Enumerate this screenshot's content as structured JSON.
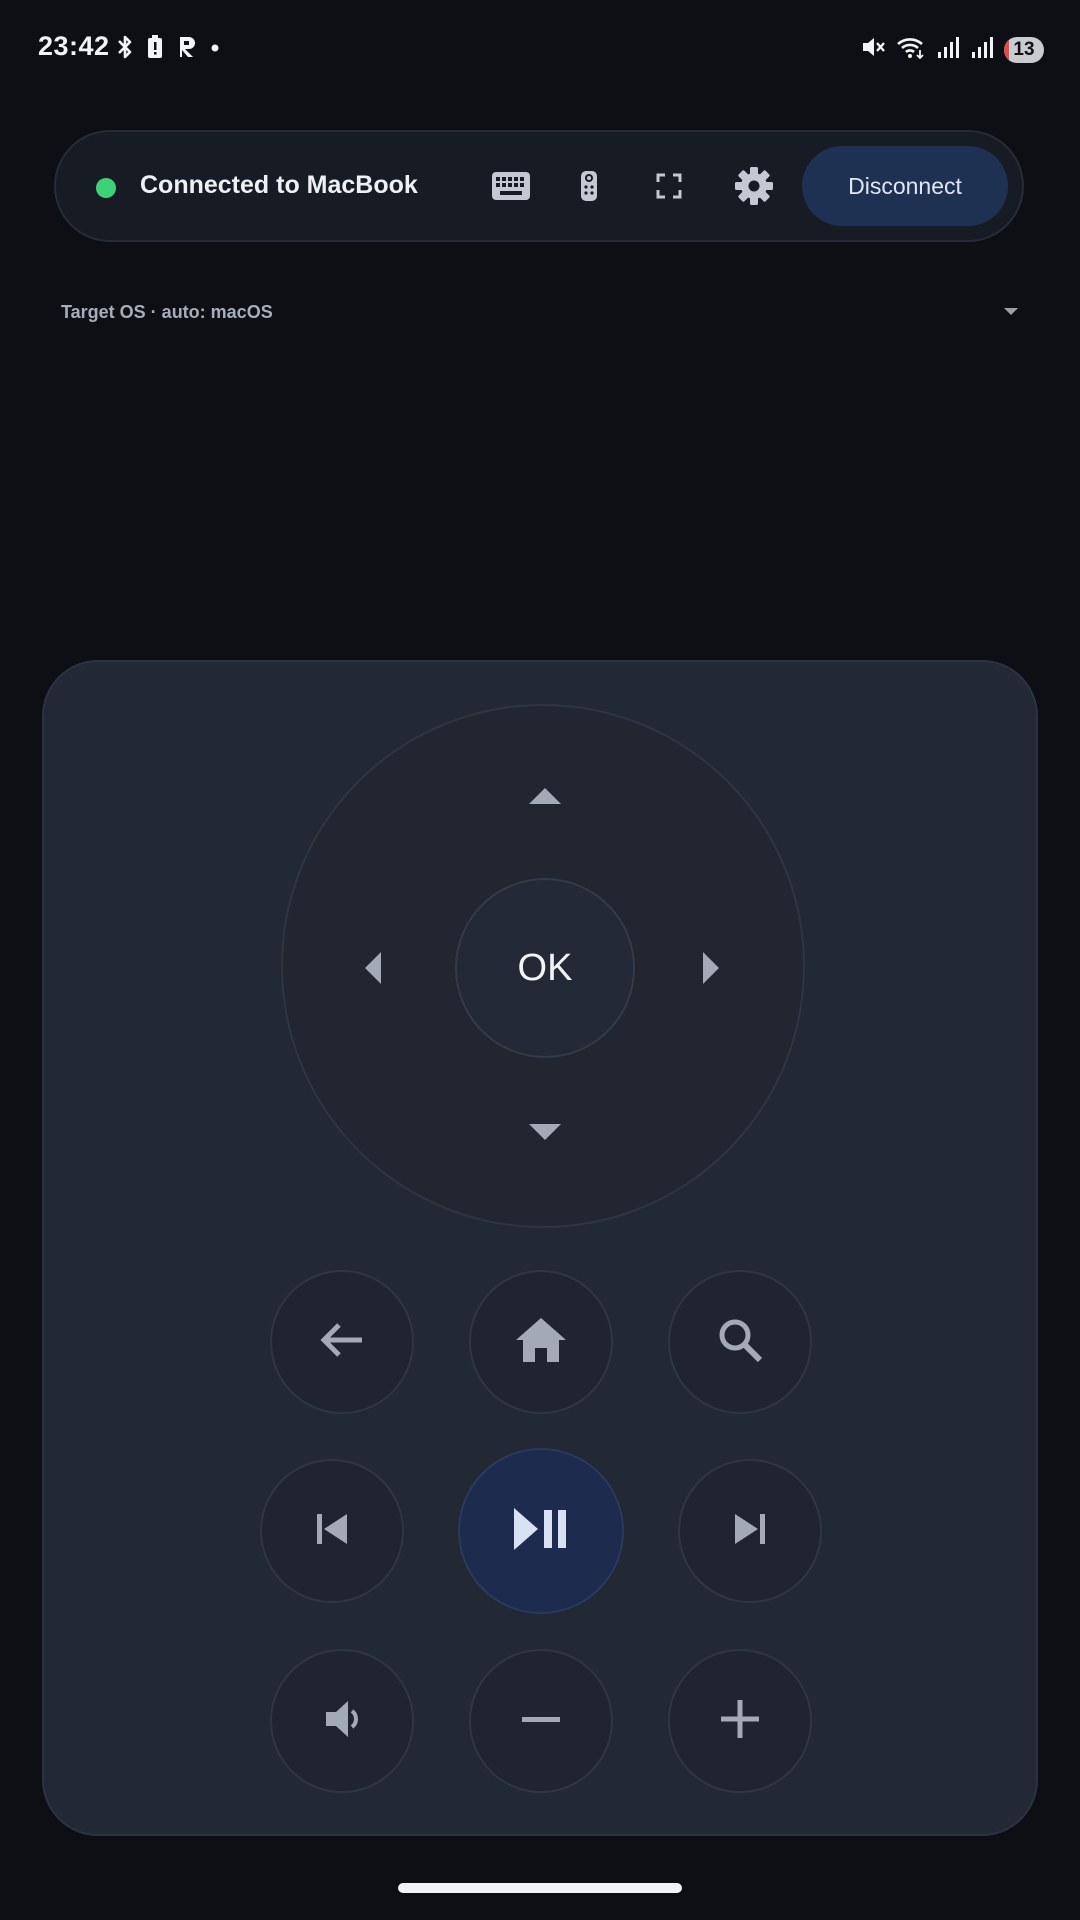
{
  "status_bar": {
    "time": "23:42",
    "left_icons": [
      "bluetooth-icon",
      "battery-saver-icon",
      "app-r-icon",
      "notification-dot-icon"
    ],
    "right_icons": [
      "mute-icon",
      "wifi-icon",
      "signal-1-icon",
      "signal-2-icon"
    ],
    "battery_level": "13",
    "battery_fraction": 0.13
  },
  "connection": {
    "status": "Connected to MacBook",
    "status_color": "#3fd07a",
    "actions": [
      "keyboard-icon",
      "remote-icon",
      "fullscreen-icon",
      "gear-icon"
    ],
    "disconnect_label": "Disconnect"
  },
  "target_os": {
    "label": "Target OS · auto: macOS"
  },
  "remote": {
    "ok_label": "OK",
    "nav_buttons": [
      "back-icon",
      "home-icon",
      "search-icon"
    ],
    "media_buttons": [
      "previous-track-icon",
      "play-pause-icon",
      "next-track-icon"
    ],
    "volume_buttons": [
      "volume-icon",
      "volume-down-icon",
      "volume-up-icon"
    ],
    "accent_color": "#1c2b4e"
  }
}
